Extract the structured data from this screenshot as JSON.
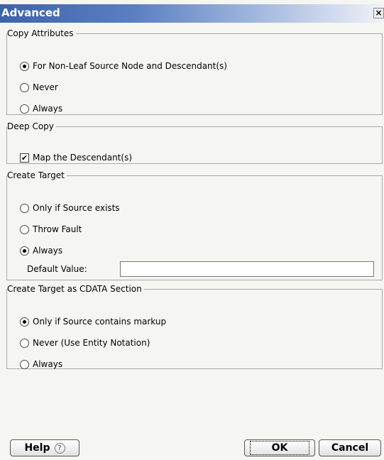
{
  "window": {
    "title": "Advanced",
    "close_label": "×"
  },
  "copy_attributes": {
    "legend": "Copy Attributes",
    "options": [
      "For Non-Leaf Source Node and Descendant(s)",
      "Never",
      "Always"
    ],
    "selected_index": 0
  },
  "deep_copy": {
    "legend": "Deep Copy",
    "checkbox_label": "Map the Descendant(s)",
    "checked": true
  },
  "create_target": {
    "legend": "Create Target",
    "options": [
      "Only if Source exists",
      "Throw Fault",
      "Always"
    ],
    "selected_index": 2,
    "default_value_label": "Default Value:",
    "default_value": ""
  },
  "cdata": {
    "legend": "Create Target as CDATA Section",
    "options": [
      "Only if Source contains markup",
      "Never (Use Entity Notation)",
      "Always"
    ],
    "selected_index": 0
  },
  "buttons": {
    "help": "Help",
    "help_icon": "?",
    "ok": "OK",
    "cancel": "Cancel"
  }
}
